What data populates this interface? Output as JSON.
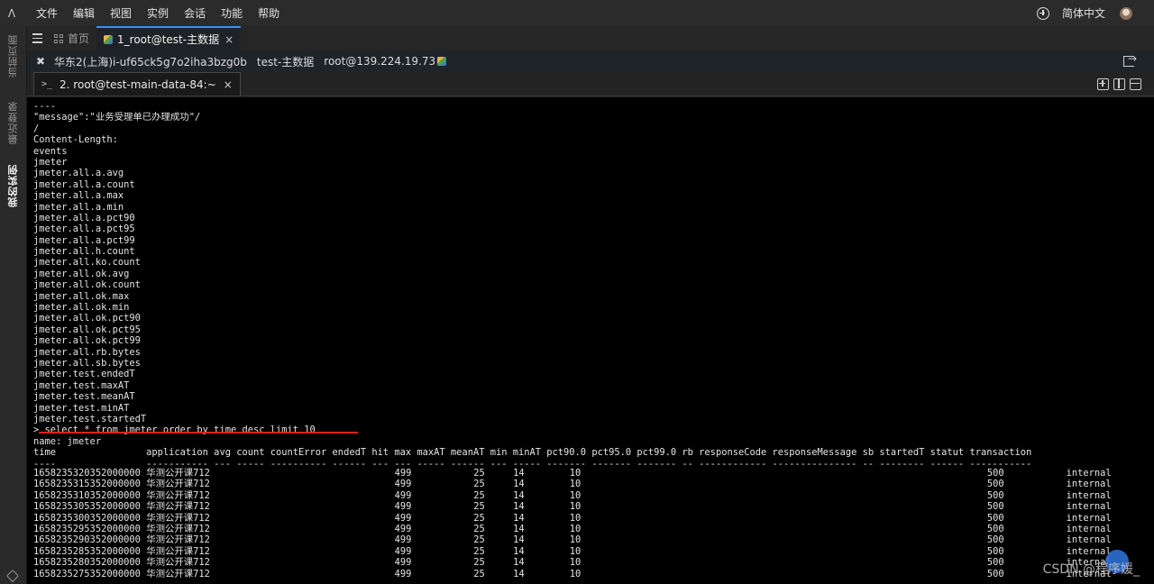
{
  "menubar": {
    "logo_glyph": "Ʌ",
    "items": [
      "文件",
      "编辑",
      "视图",
      "实例",
      "会话",
      "功能",
      "帮助"
    ],
    "language": "简体中文"
  },
  "sidebar": {
    "tabs": [
      "当前页面",
      "最近登录",
      "我的实例"
    ]
  },
  "tabs": {
    "home": "首页",
    "active": "1_root@test-主数据"
  },
  "infobar": {
    "region": "华东2(上海)i-uf65ck5g7o2iha3bzg0b",
    "env": "test-主数据",
    "host": "root@139.224.19.73"
  },
  "session_tab": {
    "prompt": ">_",
    "title": "2. root@test-main-data-84:~",
    "close": "×"
  },
  "terminal": {
    "lines": [
      "----",
      "\"message\":\"业务受理单已办理成功\"/",
      "/",
      "Content-Length:",
      "events",
      "jmeter",
      "jmeter.all.a.avg",
      "jmeter.all.a.count",
      "jmeter.all.a.max",
      "jmeter.all.a.min",
      "jmeter.all.a.pct90",
      "jmeter.all.a.pct95",
      "jmeter.all.a.pct99",
      "jmeter.all.h.count",
      "jmeter.all.ko.count",
      "jmeter.all.ok.avg",
      "jmeter.all.ok.count",
      "jmeter.all.ok.max",
      "jmeter.all.ok.min",
      "jmeter.all.ok.pct90",
      "jmeter.all.ok.pct95",
      "jmeter.all.ok.pct99",
      "jmeter.all.rb.bytes",
      "jmeter.all.sb.bytes",
      "jmeter.test.endedT",
      "jmeter.test.maxAT",
      "jmeter.test.meanAT",
      "jmeter.test.minAT",
      "jmeter.test.startedT",
      "> select * from jmeter order by time desc limit 10",
      "name: jmeter",
      "time                application avg count countError endedT hit max maxAT meanAT min minAT pct90.0 pct95.0 pct99.0 rb responseCode responseMessage sb startedT statut transaction",
      "----                ----------- --- ----- ---------- ------ --- --- ----- ------ --- ----- ------- ------- ------- -- ------------ --------------- -- -------- ------ -----------"
    ],
    "rows": [
      {
        "time": "1658235320352000000",
        "application": "华测公开课712",
        "endedT": "499",
        "maxAT": "25",
        "meanAT": "14",
        "minAT": "10",
        "startedT": "500",
        "transaction": "internal"
      },
      {
        "time": "1658235315352000000",
        "application": "华测公开课712",
        "endedT": "499",
        "maxAT": "25",
        "meanAT": "14",
        "minAT": "10",
        "startedT": "500",
        "transaction": "internal"
      },
      {
        "time": "1658235310352000000",
        "application": "华测公开课712",
        "endedT": "499",
        "maxAT": "25",
        "meanAT": "14",
        "minAT": "10",
        "startedT": "500",
        "transaction": "internal"
      },
      {
        "time": "1658235305352000000",
        "application": "华测公开课712",
        "endedT": "499",
        "maxAT": "25",
        "meanAT": "14",
        "minAT": "10",
        "startedT": "500",
        "transaction": "internal"
      },
      {
        "time": "1658235300352000000",
        "application": "华测公开课712",
        "endedT": "499",
        "maxAT": "25",
        "meanAT": "14",
        "minAT": "10",
        "startedT": "500",
        "transaction": "internal"
      },
      {
        "time": "1658235295352000000",
        "application": "华测公开课712",
        "endedT": "499",
        "maxAT": "25",
        "meanAT": "14",
        "minAT": "10",
        "startedT": "500",
        "transaction": "internal"
      },
      {
        "time": "1658235290352000000",
        "application": "华测公开课712",
        "endedT": "499",
        "maxAT": "25",
        "meanAT": "14",
        "minAT": "10",
        "startedT": "500",
        "transaction": "internal"
      },
      {
        "time": "1658235285352000000",
        "application": "华测公开课712",
        "endedT": "499",
        "maxAT": "25",
        "meanAT": "14",
        "minAT": "10",
        "startedT": "500",
        "transaction": "internal"
      },
      {
        "time": "1658235280352000000",
        "application": "华测公开课712",
        "endedT": "499",
        "maxAT": "25",
        "meanAT": "14",
        "minAT": "10",
        "startedT": "500",
        "transaction": "internal"
      },
      {
        "time": "1658235275352000000",
        "application": "华测公开课712",
        "endedT": "499",
        "maxAT": "25",
        "meanAT": "14",
        "minAT": "10",
        "startedT": "500",
        "transaction": "internal"
      }
    ]
  },
  "watermark": "CSDN @程序媛_"
}
